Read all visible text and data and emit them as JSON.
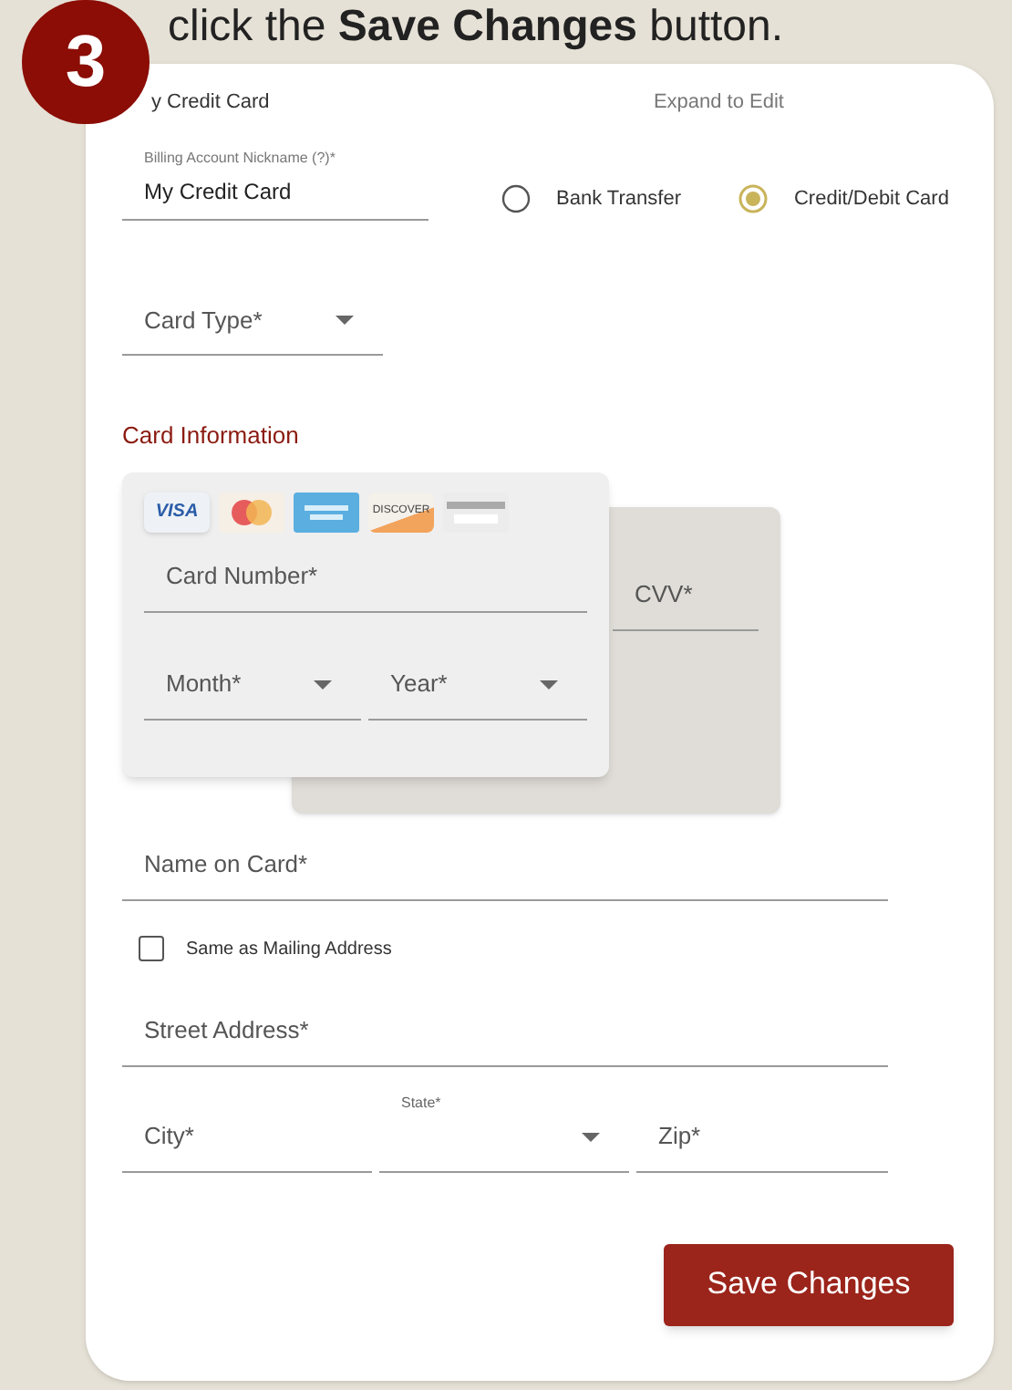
{
  "caption": "click the **Save Changes** button.",
  "step_badge": "3",
  "header": {
    "title": "y Credit Card",
    "expand_link": "Expand to Edit"
  },
  "nickname": {
    "label": "Billing Account Nickname (?)*",
    "value": "My Credit Card"
  },
  "payment_methods": [
    {
      "label": "Bank Transfer",
      "selected": false
    },
    {
      "label": "Credit/Debit Card",
      "selected": true
    }
  ],
  "card_type": {
    "placeholder": "Card Type*"
  },
  "section_title": "Card Information",
  "card_logos": [
    {
      "kind": "visa",
      "text": "VISA"
    },
    {
      "kind": "mastercard"
    },
    {
      "kind": "amex"
    },
    {
      "kind": "discover",
      "text": "DISCOVER"
    },
    {
      "kind": "generic"
    }
  ],
  "card_number": {
    "placeholder": "Card Number*"
  },
  "month": {
    "placeholder": "Month*"
  },
  "year": {
    "placeholder": "Year*"
  },
  "cvv": {
    "placeholder": "CVV*"
  },
  "name_on_card": {
    "placeholder": "Name on Card*"
  },
  "same_as_mailing": {
    "label": "Same as Mailing Address",
    "checked": false
  },
  "street": {
    "placeholder": "Street Address*"
  },
  "city": {
    "placeholder": "City*"
  },
  "state": {
    "label": "State*"
  },
  "zip": {
    "placeholder": "Zip*"
  },
  "save_button": "Save Changes"
}
